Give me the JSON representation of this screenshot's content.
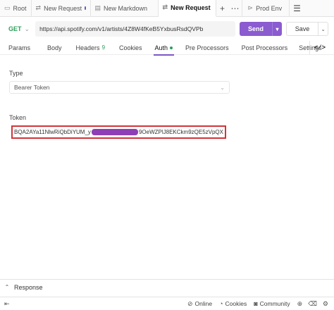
{
  "tabs": [
    {
      "label": "Root",
      "icon": "folder-icon",
      "glyph": "▭",
      "active": false,
      "dot": false
    },
    {
      "label": "New Request",
      "icon": "request-icon",
      "glyph": "⇄",
      "active": false,
      "dot": true
    },
    {
      "label": "New Markdown",
      "icon": "markdown-icon",
      "glyph": "▤",
      "active": false,
      "dot": false
    },
    {
      "label": "New Request",
      "icon": "request-icon",
      "glyph": "⇄",
      "active": true,
      "dot": true
    }
  ],
  "tabbar": {
    "add": "+",
    "more": "⋯",
    "menu": "☰"
  },
  "environment": {
    "label": "Prod Env",
    "icon": "environment-icon"
  },
  "request": {
    "method": "GET",
    "url": "https://api.spotify.com/v1/artists/4Z8W4fKeB5YxbusRsdQVPb",
    "send_label": "Send",
    "save_label": "Save"
  },
  "subtabs": [
    {
      "label": "Params",
      "active": false
    },
    {
      "label": "Body",
      "active": false
    },
    {
      "label": "Headers",
      "count": "9",
      "active": false
    },
    {
      "label": "Cookies",
      "active": false
    },
    {
      "label": "Auth",
      "active": true,
      "dot": true
    },
    {
      "label": "Pre Processors",
      "active": false
    },
    {
      "label": "Post Processors",
      "active": false
    },
    {
      "label": "Settings",
      "active": false
    }
  ],
  "code_button": "</>",
  "auth": {
    "type_label": "Type",
    "type_value": "Bearer Token",
    "token_label": "Token",
    "token_prefix": "BQA2AYa11NlwRiQbDiYUM_y",
    "token_suffix": "9OeWZPlJ8EKCkm9zQE5zVpQX"
  },
  "response": {
    "label": "Response"
  },
  "statusbar": {
    "online": "Online",
    "cookies": "Cookies",
    "community": "Community"
  },
  "colors": {
    "accent": "#8b5bd0",
    "method_get": "#2e9e5b",
    "highlight_border": "#d13438",
    "redaction": "#8e3fb5"
  }
}
